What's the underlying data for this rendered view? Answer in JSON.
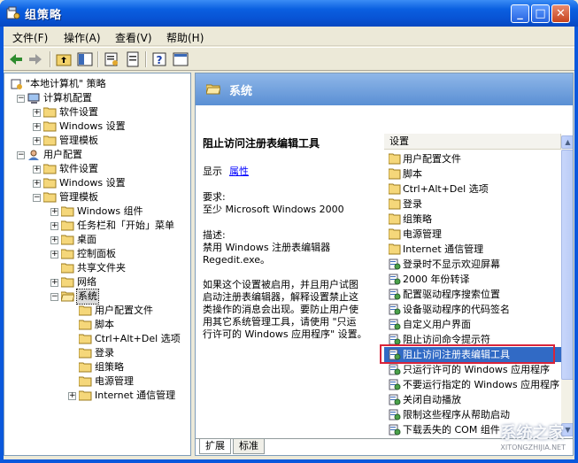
{
  "window": {
    "title": "组策略"
  },
  "menu": [
    {
      "label": "文件(F)"
    },
    {
      "label": "操作(A)"
    },
    {
      "label": "查看(V)"
    },
    {
      "label": "帮助(H)"
    }
  ],
  "tree": [
    {
      "label": "\"本地计算机\" 策略",
      "level": 0
    },
    {
      "label": "计算机配置",
      "level": 1
    },
    {
      "label": "软件设置",
      "level": 2
    },
    {
      "label": "Windows 设置",
      "level": 2
    },
    {
      "label": "管理模板",
      "level": 2
    },
    {
      "label": "用户配置",
      "level": 1
    },
    {
      "label": "软件设置",
      "level": 2
    },
    {
      "label": "Windows 设置",
      "level": 2
    },
    {
      "label": "管理模板",
      "level": 2
    },
    {
      "label": "Windows 组件",
      "level": 3
    },
    {
      "label": "任务栏和「开始」菜单",
      "level": 3
    },
    {
      "label": "桌面",
      "level": 3
    },
    {
      "label": "控制面板",
      "level": 3
    },
    {
      "label": "共享文件夹",
      "level": 3
    },
    {
      "label": "网络",
      "level": 3
    },
    {
      "label": "系统",
      "level": 3
    },
    {
      "label": "用户配置文件",
      "level": 4
    },
    {
      "label": "脚本",
      "level": 4
    },
    {
      "label": "Ctrl+Alt+Del 选项",
      "level": 4
    },
    {
      "label": "登录",
      "level": 4
    },
    {
      "label": "组策略",
      "level": 4
    },
    {
      "label": "电源管理",
      "level": 4
    },
    {
      "label": "Internet 通信管理",
      "level": 4
    }
  ],
  "right": {
    "header_title": "系统",
    "setting_title": "阻止访问注册表编辑工具",
    "display_label": "显示",
    "properties_link": "属性",
    "requirements_label": "要求:",
    "requirements_value": "至少 Microsoft Windows 2000",
    "description_label": "描述:",
    "description_line1": "禁用 Windows 注册表编辑器",
    "description_line2": "Regedit.exe。",
    "body_lines": [
      "如果这个设置被启用，并且用户试图",
      "启动注册表编辑器，解释设置禁止这",
      "类操作的消息会出现。要防止用户使",
      "用其它系统管理工具，请使用 \"只运",
      "行许可的 Windows 应用程序\" 设置。"
    ],
    "list_header": "设置",
    "list_items": [
      {
        "label": "用户配置文件",
        "type": "folder"
      },
      {
        "label": "脚本",
        "type": "folder"
      },
      {
        "label": "Ctrl+Alt+Del 选项",
        "type": "folder"
      },
      {
        "label": "登录",
        "type": "folder"
      },
      {
        "label": "组策略",
        "type": "folder"
      },
      {
        "label": "电源管理",
        "type": "folder"
      },
      {
        "label": "Internet 通信管理",
        "type": "folder"
      },
      {
        "label": "登录时不显示欢迎屏幕",
        "type": "policy"
      },
      {
        "label": "2000 年份转译",
        "type": "policy"
      },
      {
        "label": "配置驱动程序搜索位置",
        "type": "policy"
      },
      {
        "label": "设备驱动程序的代码签名",
        "type": "policy"
      },
      {
        "label": "自定义用户界面",
        "type": "policy"
      },
      {
        "label": "阻止访问命令提示符",
        "type": "policy"
      },
      {
        "label": "阻止访问注册表编辑工具",
        "type": "policy"
      },
      {
        "label": "只运行许可的 Windows 应用程序",
        "type": "policy"
      },
      {
        "label": "不要运行指定的 Windows 应用程序",
        "type": "policy"
      },
      {
        "label": "关闭自动播放",
        "type": "policy"
      },
      {
        "label": "限制这些程序从帮助启动",
        "type": "policy"
      },
      {
        "label": "下载丢失的 COM 组件",
        "type": "policy"
      }
    ],
    "tabs": [
      {
        "label": "扩展"
      },
      {
        "label": "标准"
      }
    ]
  },
  "watermark": {
    "text": "系统之家",
    "url_text": "XITONGZHIJIA.NET"
  },
  "colors": {
    "title_blue": "#0a5fe0",
    "selection": "#316ac5",
    "highlight_red": "#d9243a"
  }
}
